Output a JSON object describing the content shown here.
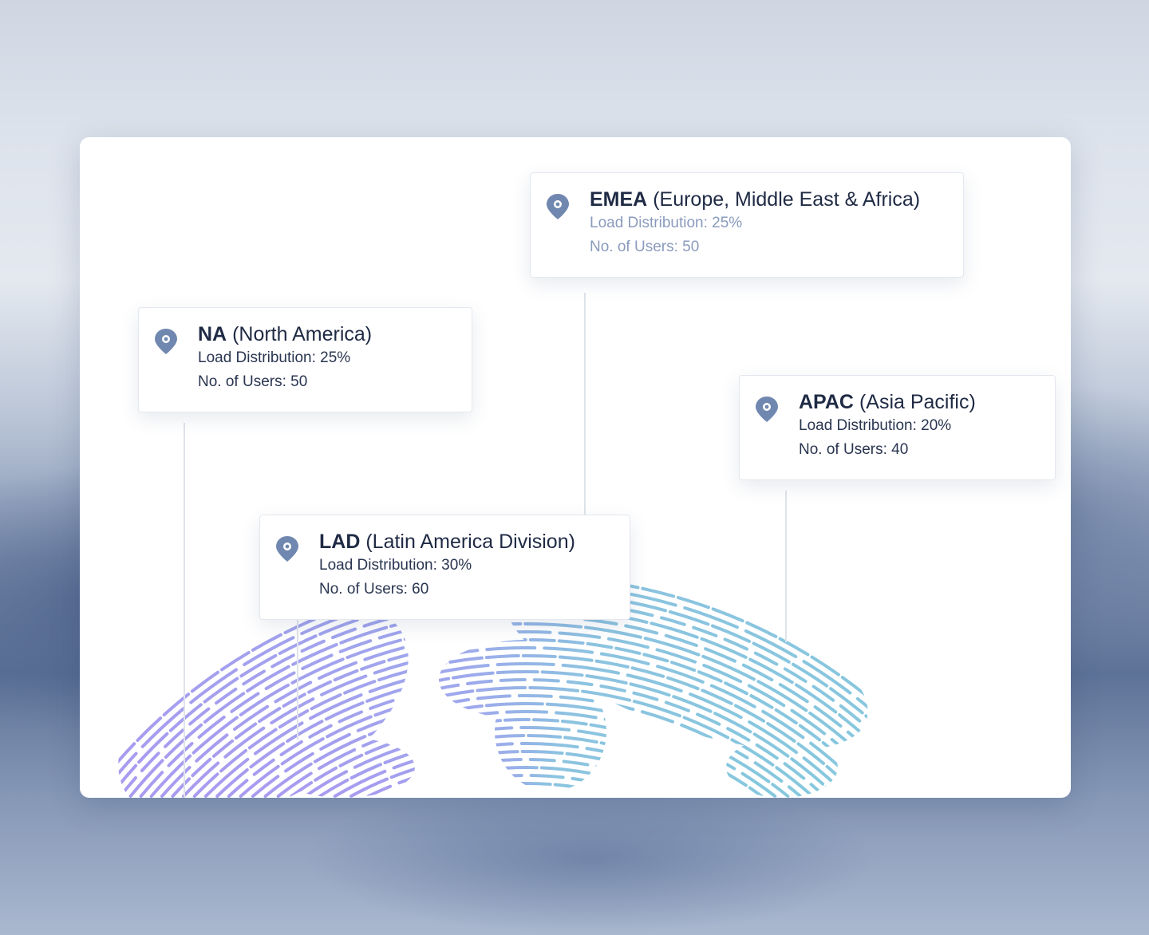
{
  "colors": {
    "pin": "#7088b0",
    "arc_start": "#a79af0",
    "arc_end": "#86c8de"
  },
  "regions": [
    {
      "id": "na",
      "code": "NA",
      "name": "(North America)",
      "load": "Load Distribution: 25%",
      "users": "No. of Users: 50"
    },
    {
      "id": "emea",
      "code": "EMEA",
      "name": "(Europe, Middle East & Africa)",
      "load": "Load Distribution: 25%",
      "users": "No. of Users: 50"
    },
    {
      "id": "apac",
      "code": "APAC",
      "name": "(Asia Pacific)",
      "load": "Load Distribution: 20%",
      "users": "No. of Users: 40"
    },
    {
      "id": "lad",
      "code": "LAD",
      "name": "(Latin America Division)",
      "load": "Load Distribution: 30%",
      "users": "No. of Users: 60"
    }
  ]
}
